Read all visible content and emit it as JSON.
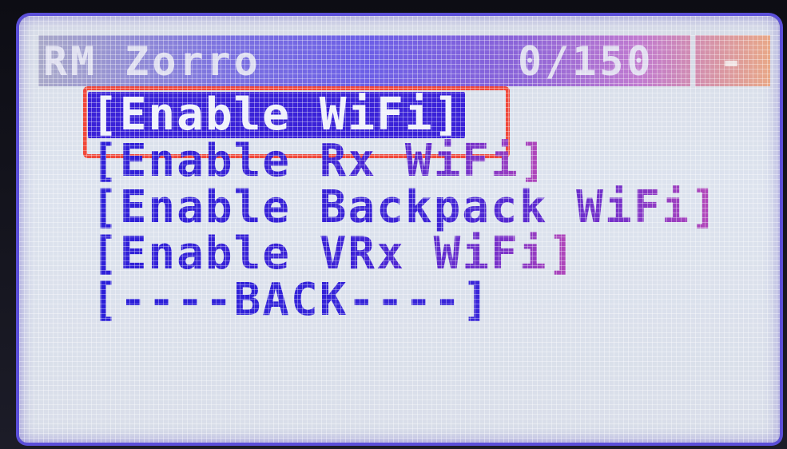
{
  "header": {
    "title": "RM Zorro",
    "counter": "0/150",
    "indicator": "-"
  },
  "menu": {
    "items": [
      {
        "label": "[Enable WiFi]",
        "selected": true
      },
      {
        "label": "[Enable Rx WiFi]",
        "selected": false
      },
      {
        "label": "[Enable Backpack WiFi]",
        "selected": false
      },
      {
        "label": "[Enable VRx WiFi]",
        "selected": false
      },
      {
        "label": "[----BACK----]",
        "selected": false
      }
    ]
  },
  "colors": {
    "text": "#3b2cd6",
    "highlight": "#f0483a",
    "screen": "#d8dde8",
    "border": "#5b4fd8"
  }
}
